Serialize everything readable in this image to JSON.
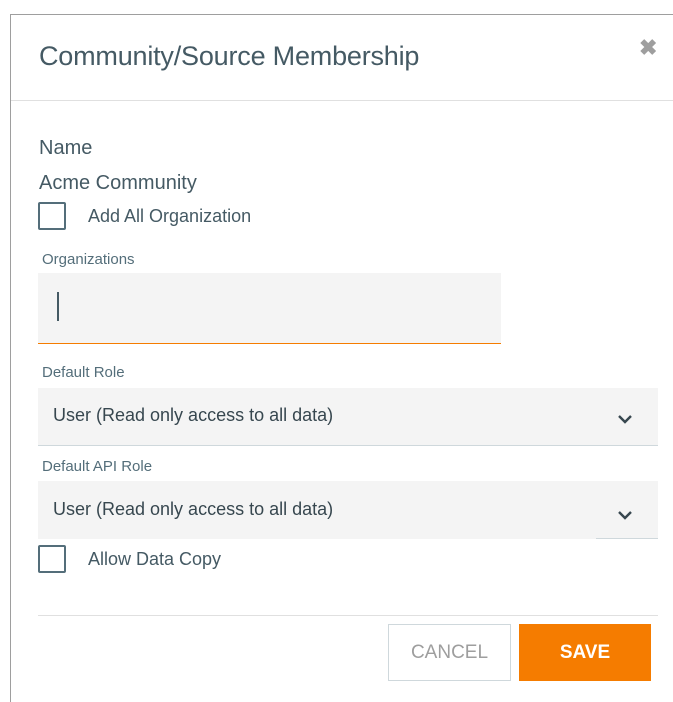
{
  "dialog": {
    "title": "Community/Source Membership",
    "close_icon": "close-icon",
    "close_glyph": "✖"
  },
  "form": {
    "name_label": "Name",
    "name_value": "Acme Community",
    "add_all_org": {
      "label": "Add All Organization",
      "checked": false
    },
    "organizations": {
      "label": "Organizations",
      "value": ""
    },
    "default_role": {
      "label": "Default Role",
      "value": "User (Read only access to all data)"
    },
    "default_api_role": {
      "label": "Default API Role",
      "value": "User (Read only access to all data)"
    },
    "allow_data_copy": {
      "label": "Allow Data Copy",
      "checked": false
    }
  },
  "actions": {
    "cancel_label": "CANCEL",
    "save_label": "SAVE"
  },
  "colors": {
    "accent": "#f57c00",
    "text": "#455a64",
    "input_bg": "#f4f4f4"
  }
}
